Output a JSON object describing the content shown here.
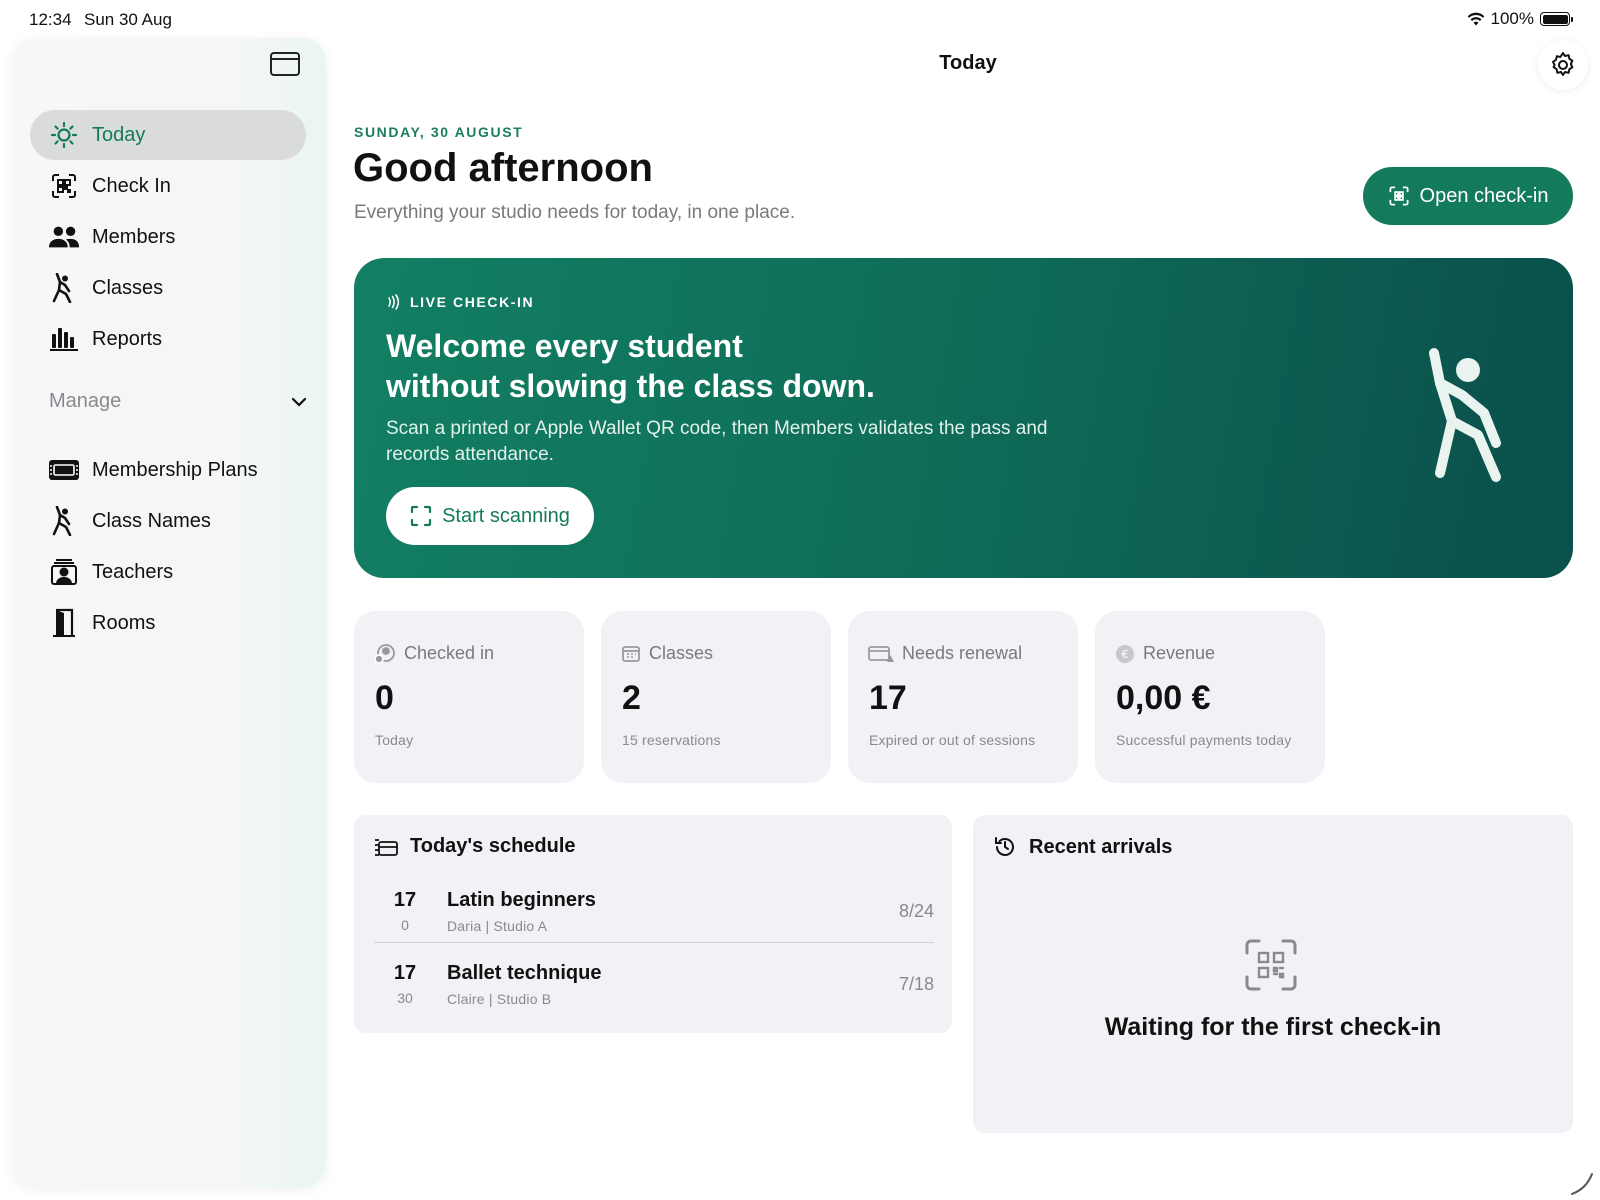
{
  "status_bar": {
    "time": "12:34",
    "date": "Sun 30 Aug",
    "battery": "100%"
  },
  "sidebar": {
    "items": [
      {
        "label": "Today",
        "icon": "sun-icon",
        "active": true
      },
      {
        "label": "Check In",
        "icon": "qr-scan-icon"
      },
      {
        "label": "Members",
        "icon": "people-icon"
      },
      {
        "label": "Classes",
        "icon": "dancer-icon"
      },
      {
        "label": "Reports",
        "icon": "bar-chart-icon"
      }
    ],
    "section": "Manage",
    "manage_items": [
      {
        "label": "Membership Plans",
        "icon": "ticket-icon"
      },
      {
        "label": "Class Names",
        "icon": "dancer-icon"
      },
      {
        "label": "Teachers",
        "icon": "teacher-icon"
      },
      {
        "label": "Rooms",
        "icon": "door-icon"
      }
    ]
  },
  "header": {
    "title": "Today"
  },
  "main": {
    "date_label": "SUNDAY, 30 AUGUST",
    "greeting": "Good afternoon",
    "subtitle": "Everything your studio needs for today, in one place.",
    "open_checkin_label": "Open check-in"
  },
  "hero": {
    "tag": "LIVE CHECK-IN",
    "title_line1": "Welcome every student",
    "title_line2": "without slowing the class down.",
    "description": "Scan a printed or Apple Wallet QR code, then Members validates the pass and records attendance.",
    "button_label": "Start scanning"
  },
  "stats": [
    {
      "label": "Checked in",
      "value": "0",
      "foot": "Today",
      "icon": "person-check-icon"
    },
    {
      "label": "Classes",
      "value": "2",
      "foot": "15 reservations",
      "icon": "calendar-icon"
    },
    {
      "label": "Needs renewal",
      "value": "17",
      "foot": "Expired or out of sessions",
      "icon": "card-warning-icon"
    },
    {
      "label": "Revenue",
      "value": "0,00 €",
      "foot": "Successful payments today",
      "icon": "euro-icon"
    }
  ],
  "schedule": {
    "title": "Today's schedule",
    "rows": [
      {
        "hour": "17",
        "minute": "0",
        "name": "Latin beginners",
        "meta": "Daria | Studio A",
        "count": "8/24"
      },
      {
        "hour": "17",
        "minute": "30",
        "name": "Ballet technique",
        "meta": "Claire | Studio B",
        "count": "7/18"
      }
    ]
  },
  "arrivals": {
    "title": "Recent arrivals",
    "empty_text": "Waiting for the first check-in"
  },
  "colors": {
    "accent": "#137a5b",
    "accent_dark": "#0a4f4b",
    "card_bg": "#f1f1f6"
  }
}
